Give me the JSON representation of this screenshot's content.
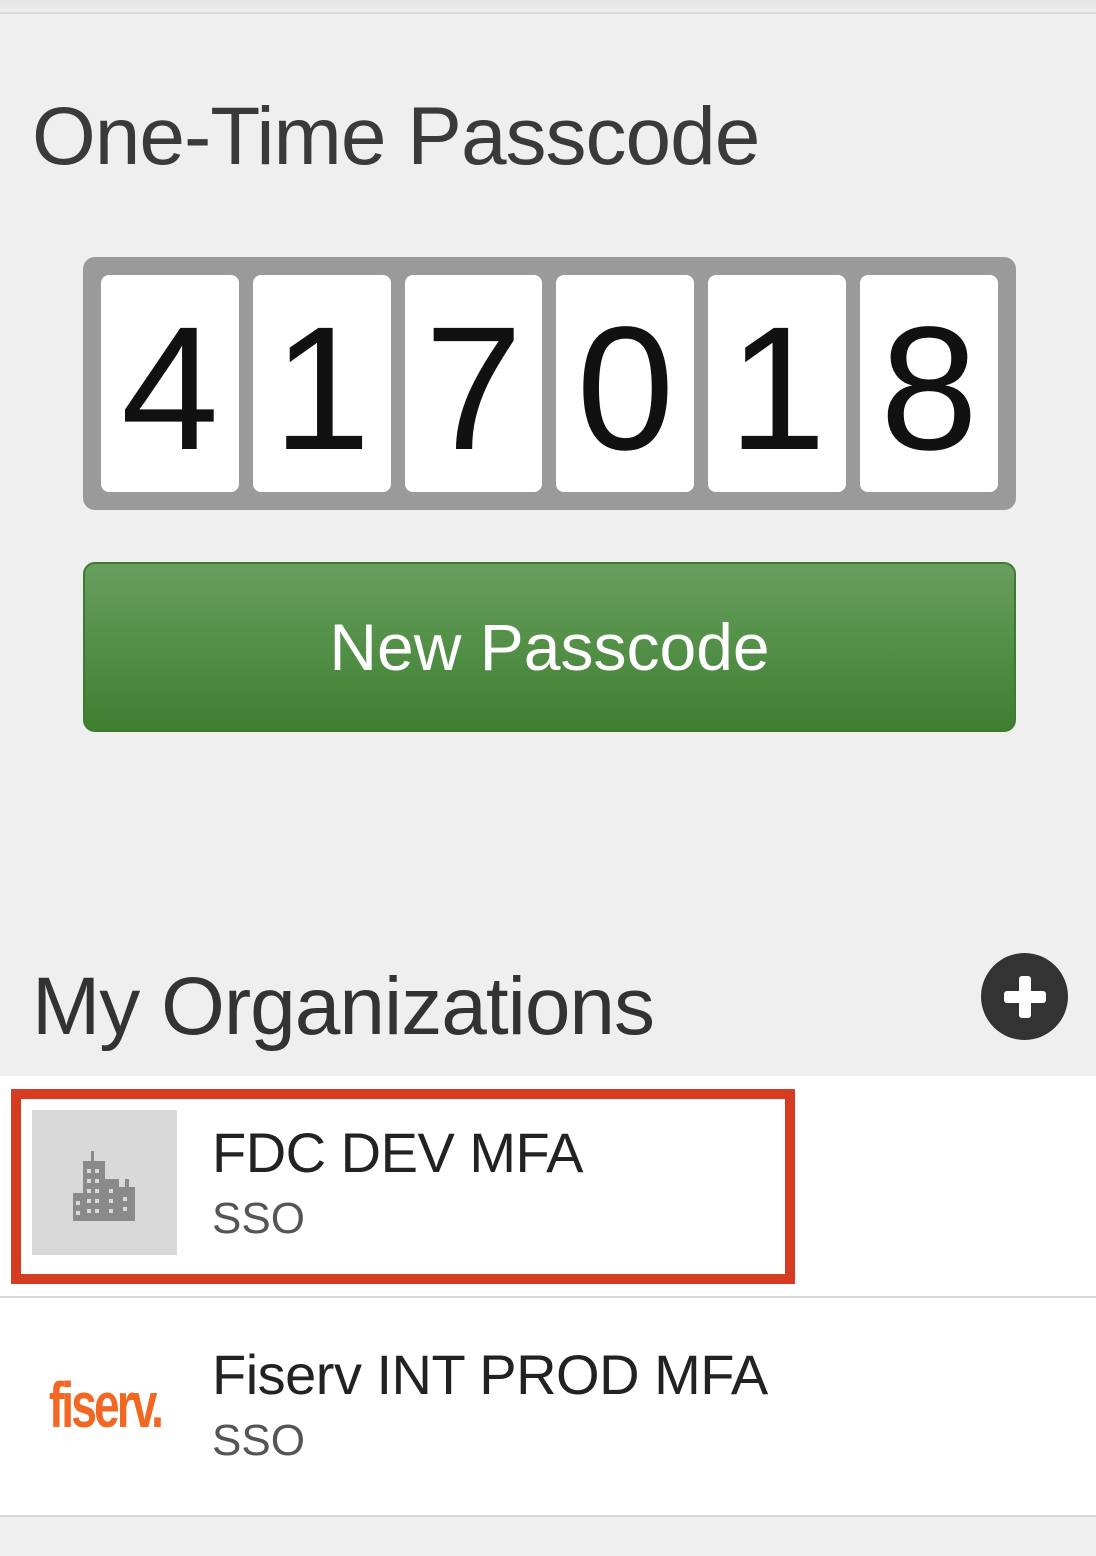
{
  "otp": {
    "title": "One-Time Passcode",
    "digits": [
      "4",
      "1",
      "7",
      "0",
      "1",
      "8"
    ],
    "new_button_label": "New Passcode"
  },
  "organizations": {
    "title": "My Organizations",
    "add_icon": "plus-circle-icon",
    "items": [
      {
        "name": "FDC DEV MFA",
        "type": "SSO",
        "logo": "building-icon",
        "highlighted": true
      },
      {
        "name": "Fiserv INT PROD MFA",
        "type": "SSO",
        "logo_text": "fiserv."
      }
    ]
  },
  "colors": {
    "button_green": "#4f8c42",
    "highlight_red": "#d53c22",
    "fiserv_orange": "#f26722"
  }
}
